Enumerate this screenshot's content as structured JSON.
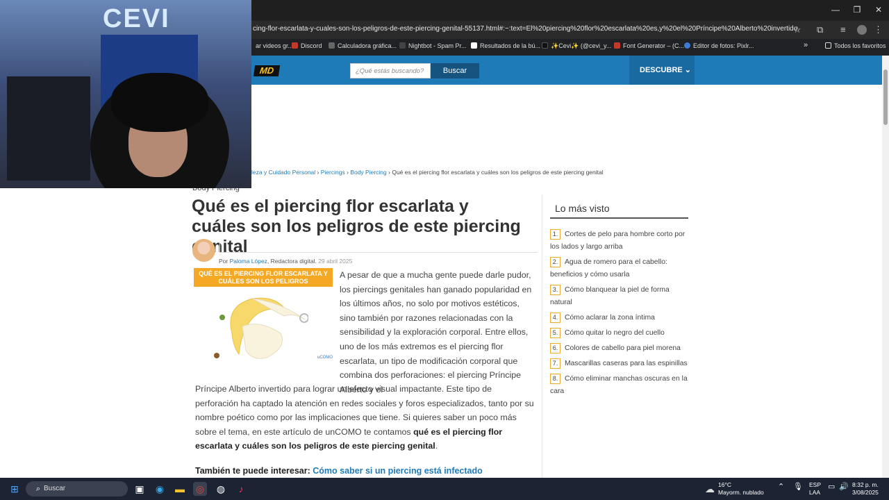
{
  "browser": {
    "url": "cing-flor-escarlata-y-cuales-son-los-peligros-de-este-piercing-genital-55137.html#:~:text=El%20piercing%20flor%20escarlata%20es,y%20el%20Príncipe%20Alberto%20invertido.",
    "bookmarks": [
      "ar videos gr...",
      "Discord",
      "Calculadora gráfica...",
      "Nightbot - Spam Pr...",
      "Resultados de la bú...",
      "✨Cevi✨ (@cevi_y...",
      "Font Generator – (C...",
      "Editor de fotos: Pixlr..."
    ],
    "bookmarks_more": "»",
    "all_bookmarks": "Todos los favoritos",
    "window_controls": [
      "—",
      "❐",
      "✕"
    ]
  },
  "webcam": {
    "sign_text": "CEVI"
  },
  "site": {
    "logo": "MD",
    "search_placeholder": "¿Qué estás buscando?",
    "search_button": "Buscar",
    "descubre": "DESCUBRE"
  },
  "breadcrumb": {
    "item1": "leza y Cuidado Personal",
    "item2": "Piercings",
    "item3": "Body Piercing",
    "current": "Qué es el piercing flor escarlata y cuáles son los peligros de este piercing genital",
    "separator": "›"
  },
  "article": {
    "category": "Body Piercing",
    "title": "Qué es el piercing flor escarlata y cuáles son los peligros de este piercing genital",
    "byline_prefix": "Por ",
    "author": "Paloma López",
    "author_role": ", Redactora digital.",
    "date": "29 abril 2025",
    "image_title": "QUÉ ES EL PIERCING FLOR ESCARLATA Y CUÁLES SON LOS PELIGROS",
    "image_credit": "uCOMO",
    "para1": "A pesar de que a mucha gente puede darle pudor, los piercings genitales han ganado popularidad en los últimos años, no solo por motivos estéticos, sino también por razones relacionadas con la sensibilidad y la exploración corporal. Entre ellos, uno de los más extremos es el piercing flor escarlata, un tipo de modificación corporal que combina dos perforaciones: el piercing Príncipe Alberto y el",
    "para2_start": "Príncipe Alberto invertido para lograr un efecto visual impactante. Este tipo de perforación ha captado la atención en redes sociales y foros especializados, tanto por su nombre poético como por las implicaciones que tiene. Si quieres saber un poco más sobre el tema, en este artículo de unCOMO te contamos ",
    "para2_bold": "qué es el piercing flor escarlata y cuáles son los peligros de este piercing genital",
    "para2_end": ".",
    "interest_label": "También te puede interesar: ",
    "interest_link": "Cómo saber si un piercing está infectado"
  },
  "sidebar": {
    "title": "Lo más visto",
    "items": [
      {
        "num": "1.",
        "label": "Cortes de pelo para hombre corto por los lados y largo arriba"
      },
      {
        "num": "2.",
        "label": "Agua de romero para el cabello: beneficios y cómo usarla"
      },
      {
        "num": "3.",
        "label": "Cómo blanquear la piel de forma natural"
      },
      {
        "num": "4.",
        "label": "Cómo aclarar la zona íntima"
      },
      {
        "num": "5.",
        "label": "Cómo quitar lo negro del cuello"
      },
      {
        "num": "6.",
        "label": "Colores de cabello para piel morena"
      },
      {
        "num": "7.",
        "label": "Mascarillas caseras para las espinillas"
      },
      {
        "num": "8.",
        "label": "Cómo eliminar manchas oscuras en la cara"
      }
    ]
  },
  "taskbar": {
    "search": "Buscar",
    "weather_temp": "16°C",
    "weather_desc": "Mayorm. nublado",
    "lang1": "ESP",
    "lang2": "LAA",
    "time": "8:32 p. m.",
    "date": "3/08/2025"
  },
  "colors": {
    "site_bar": "#1f7bb8",
    "accent": "#f5a823",
    "link": "#1f7bb8"
  }
}
